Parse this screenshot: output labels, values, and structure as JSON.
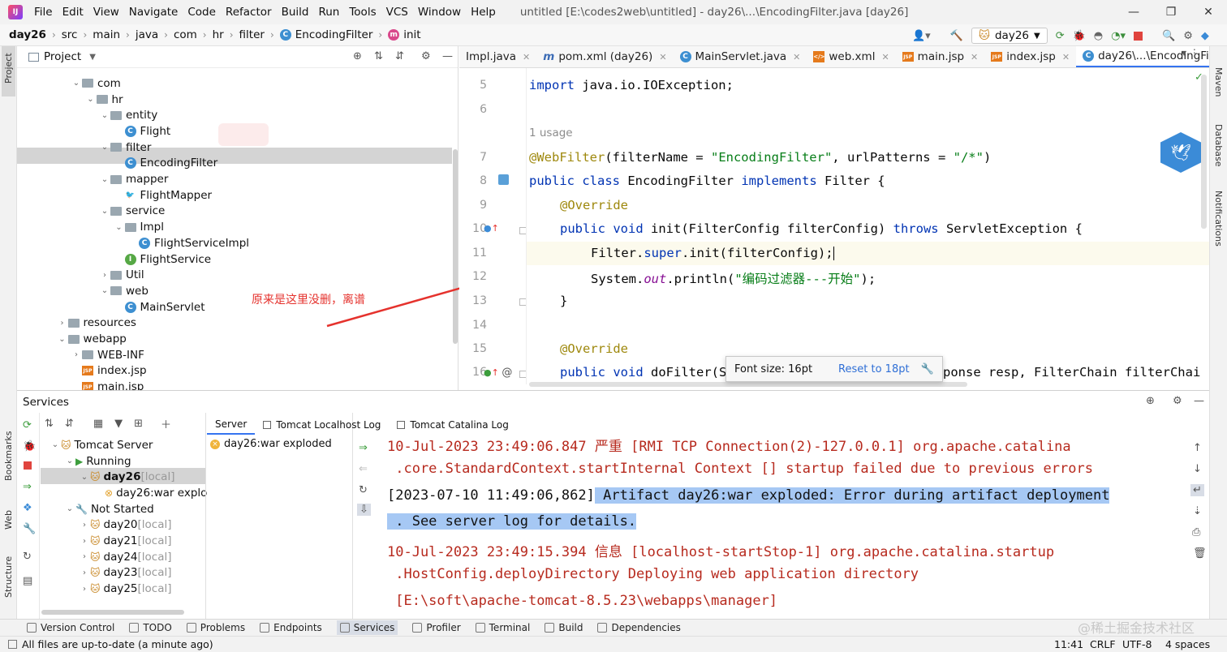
{
  "menu": [
    "File",
    "Edit",
    "View",
    "Navigate",
    "Code",
    "Refactor",
    "Build",
    "Run",
    "Tools",
    "VCS",
    "Window",
    "Help"
  ],
  "window_title": "untitled [E:\\codes2web\\untitled] - day26\\...\\EncodingFilter.java [day26]",
  "breadcrumbs": [
    "day26",
    "src",
    "main",
    "java",
    "com",
    "hr",
    "filter",
    "EncodingFilter",
    "init"
  ],
  "run_config": "day26",
  "project_panel": {
    "title": "Project",
    "tree": [
      {
        "label": "com",
        "kind": "folder",
        "depth": 0,
        "arrow": "v"
      },
      {
        "label": "hr",
        "kind": "folder",
        "depth": 1,
        "arrow": "v"
      },
      {
        "label": "entity",
        "kind": "folder",
        "depth": 2,
        "arrow": "v"
      },
      {
        "label": "Flight",
        "kind": "class",
        "depth": 3,
        "arrow": ""
      },
      {
        "label": "filter",
        "kind": "folder",
        "depth": 2,
        "arrow": "v"
      },
      {
        "label": "EncodingFilter",
        "kind": "class",
        "depth": 3,
        "arrow": ""
      },
      {
        "label": "mapper",
        "kind": "folder",
        "depth": 2,
        "arrow": "v"
      },
      {
        "label": "FlightMapper",
        "kind": "mapper",
        "depth": 3,
        "arrow": ""
      },
      {
        "label": "service",
        "kind": "folder",
        "depth": 2,
        "arrow": "v"
      },
      {
        "label": "Impl",
        "kind": "folder",
        "depth": 3,
        "arrow": "v"
      },
      {
        "label": "FlightServiceImpl",
        "kind": "class",
        "depth": 4,
        "arrow": ""
      },
      {
        "label": "FlightService",
        "kind": "interface",
        "depth": 3,
        "arrow": ""
      },
      {
        "label": "Util",
        "kind": "folder",
        "depth": 2,
        "arrow": ">"
      },
      {
        "label": "web",
        "kind": "folder",
        "depth": 2,
        "arrow": "v"
      },
      {
        "label": "MainServlet",
        "kind": "class",
        "depth": 3,
        "arrow": ""
      },
      {
        "label": "resources",
        "kind": "folder",
        "depth": -1,
        "arrow": ">"
      },
      {
        "label": "webapp",
        "kind": "folder",
        "depth": -1,
        "arrow": "v"
      },
      {
        "label": "WEB-INF",
        "kind": "folder",
        "depth": 0,
        "arrow": ">"
      },
      {
        "label": "index.jsp",
        "kind": "jsp",
        "depth": 0,
        "arrow": ""
      },
      {
        "label": "main.jsp",
        "kind": "jsp",
        "depth": 0,
        "arrow": ""
      }
    ]
  },
  "annotation": "原来是这里没删，离谱",
  "editor_tabs": [
    {
      "label": "Impl.java",
      "active": false
    },
    {
      "label": "pom.xml (day26)",
      "active": false
    },
    {
      "label": "MainServlet.java",
      "active": false
    },
    {
      "label": "web.xml",
      "active": false
    },
    {
      "label": "main.jsp",
      "active": false
    },
    {
      "label": "index.jsp",
      "active": false
    },
    {
      "label": "day26\\...\\EncodingFilter.java",
      "active": true
    }
  ],
  "code": {
    "ln5": "5",
    "ln6": "6",
    "ln7": "7",
    "ln8": "8",
    "ln9": "9",
    "ln10": "10",
    "ln11": "11",
    "ln12": "12",
    "ln13": "13",
    "ln14": "14",
    "ln15": "15",
    "ln16": "16",
    "import_kw": "import",
    "import_rest": " java.io.IOException;",
    "usage": "1 usage",
    "ann_webfilter": "@WebFilter",
    "wf_a": "(filterName = ",
    "wf_s1": "\"EncodingFilter\"",
    "wf_b": ", urlPatterns = ",
    "wf_s2": "\"/*\"",
    "wf_c": ")",
    "public": "public",
    "class": "class",
    "classname": " EncodingFilter ",
    "implements": "implements",
    "filter_brace": " Filter {",
    "override": "@Override",
    "void": "void",
    "init_sig": " init(FilterConfig filterConfig) ",
    "throws": "throws",
    "init_exc": " ServletException {",
    "super_a": "Filter.",
    "super_kw": "super",
    "super_b": ".init(filterConfig);",
    "sys_a": "System.",
    "sys_out": "out",
    "sys_b": ".println(",
    "sys_str": "\"编码过滤器---开始\"",
    "sys_c": ");",
    "close_brace": "}",
    "dofilter_a": " doFilter(S",
    "dofilter_b": "ponse resp, FilterChain filterChai"
  },
  "font_popup": {
    "label": "Font size: 16pt",
    "reset": "Reset to 18pt"
  },
  "services": {
    "title": "Services",
    "tree": [
      {
        "label": "Tomcat Server",
        "depth": 0,
        "arrow": "v"
      },
      {
        "label": "Running",
        "depth": 1,
        "arrow": "v"
      },
      {
        "label": "day26",
        "suffix": " [local]",
        "depth": 2,
        "arrow": "v"
      },
      {
        "label": "day26:war explo",
        "suffix": "",
        "depth": 3,
        "arrow": ""
      },
      {
        "label": "Not Started",
        "depth": 1,
        "arrow": "v"
      },
      {
        "label": "day20",
        "suffix": " [local]",
        "depth": 2,
        "arrow": ">"
      },
      {
        "label": "day21",
        "suffix": " [local]",
        "depth": 2,
        "arrow": ">"
      },
      {
        "label": "day24",
        "suffix": " [local]",
        "depth": 2,
        "arrow": ">"
      },
      {
        "label": "day23",
        "suffix": " [local]",
        "depth": 2,
        "arrow": ">"
      },
      {
        "label": "day25",
        "suffix": " [local]",
        "depth": 2,
        "arrow": ">"
      }
    ],
    "log_tabs": [
      "Server",
      "Tomcat Localhost Log",
      "Tomcat Catalina Log"
    ],
    "artifact": "day26:war exploded",
    "log": {
      "l1": "10-Jul-2023 23:49:06.847 严重 [RMI TCP Connection(2)-127.0.0.1] org.apache.catalina",
      "l2": " .core.StandardContext.startInternal Context [] startup failed due to previous errors",
      "l3a": "[2023-07-10 11:49:06,862]",
      "l3b": " Artifact day26:war exploded: Error during artifact deployment",
      "l4": " . See server log for details.",
      "l5": "10-Jul-2023 23:49:15.394 信息 [localhost-startStop-1] org.apache.catalina.startup",
      "l6": " .HostConfig.deployDirectory Deploying web application directory",
      "l7": " [E:\\soft\\apache-tomcat-8.5.23\\webapps\\manager]"
    }
  },
  "bottom_tools": [
    "Version Control",
    "TODO",
    "Problems",
    "Endpoints",
    "Services",
    "Profiler",
    "Terminal",
    "Build",
    "Dependencies"
  ],
  "status": {
    "message": "All files are up-to-date (a minute ago)",
    "pos": "11:41",
    "eol": "CRLF",
    "enc": "UTF-8",
    "indent": "4 spaces",
    "watermark": "@稀土掘金技术社区"
  },
  "strips": {
    "project": "Project",
    "bookmarks": "Bookmarks",
    "web": "Web",
    "structure": "Structure",
    "maven": "Maven",
    "database": "Database",
    "notifications": "Notifications"
  },
  "colors": {
    "accent": "#3574f0",
    "annotation": "#e5322d",
    "selection": "#a6c8f4"
  }
}
